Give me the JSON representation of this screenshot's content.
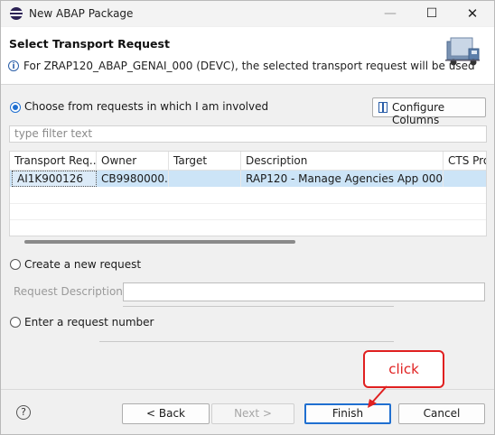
{
  "window": {
    "title": "New ABAP Package",
    "controls": {
      "minimize": "—",
      "maximize": "☐",
      "close": "✕"
    }
  },
  "header": {
    "title": "Select Transport Request",
    "message": "For ZRAP120_ABAP_GENAI_000 (DEVC), the selected transport request will be used",
    "banner_icon": "truck-icon"
  },
  "involved": {
    "label": "Choose from requests in which I am involved",
    "selected": true,
    "configure_columns_label": "Configure Columns",
    "filter_placeholder": "type filter text"
  },
  "table": {
    "columns": [
      "Transport Req...",
      "Owner",
      "Target",
      "Description",
      "CTS Proje"
    ],
    "rows": [
      {
        "transport": "AI1K900126",
        "owner": "CB9980000...",
        "target": "",
        "description": "RAP120 - Manage Agencies App 000",
        "cts": ""
      }
    ]
  },
  "new_request": {
    "label": "Create a new request",
    "description_label": "Request Description: *",
    "description_value": ""
  },
  "enter_number": {
    "label": "Enter a request number"
  },
  "buttons": {
    "back": "< Back",
    "next": "Next >",
    "finish": "Finish",
    "cancel": "Cancel"
  },
  "annotation": {
    "text": "click"
  },
  "colors": {
    "accent": "#1f6fd0",
    "selected_row": "#cce4f7",
    "annotation": "#e02020"
  }
}
